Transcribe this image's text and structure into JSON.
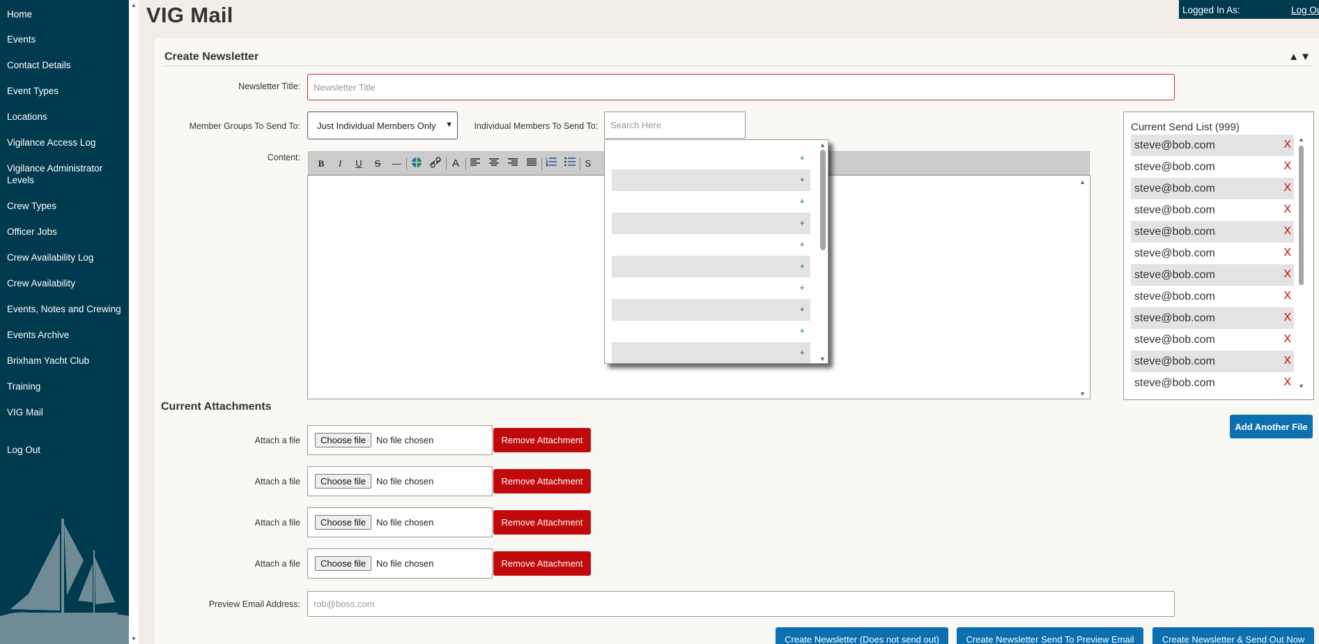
{
  "app": {
    "title": "VIG Mail",
    "logged_in_label": "Logged In As:",
    "logout_link": "Log Out"
  },
  "sidebar": {
    "items": [
      {
        "label": "Home"
      },
      {
        "label": "Events"
      },
      {
        "label": "Contact Details"
      },
      {
        "label": "Event Types"
      },
      {
        "label": "Locations"
      },
      {
        "label": "Vigilance Access Log"
      },
      {
        "label": "Vigilance Administrator Levels"
      },
      {
        "label": "Crew Types"
      },
      {
        "label": "Officer Jobs"
      },
      {
        "label": "Crew Availability Log"
      },
      {
        "label": "Crew Availability"
      },
      {
        "label": "Events, Notes and Crewing"
      },
      {
        "label": "Events Archive"
      },
      {
        "label": "Brixham Yacht Club"
      },
      {
        "label": "Training"
      },
      {
        "label": "VIG Mail"
      },
      {
        "label": "Log Out"
      }
    ]
  },
  "panel": {
    "title": "Create Newsletter",
    "toggle": "▲▼"
  },
  "form": {
    "title_label": "Newsletter Title:",
    "title_placeholder": "Newsletter Title",
    "groups_label": "Member Groups To Send To:",
    "groups_selected": "Just Individual Members Only",
    "individuals_label": "Individual Members To Send To:",
    "search_placeholder": "Search Here",
    "content_label": "Content:",
    "preview_label": "Preview Email Address:",
    "preview_placeholder": "rob@boss.com"
  },
  "toolbar": {
    "bold": "B",
    "italic": "I",
    "underline": "U",
    "strike": "S",
    "hr": "—",
    "font_size": "A",
    "source": "S"
  },
  "search_results": {
    "rows": [
      {
        "add": "+"
      },
      {
        "add": "+"
      },
      {
        "add": "+"
      },
      {
        "add": "+"
      },
      {
        "add": "+"
      },
      {
        "add": "+"
      },
      {
        "add": "+"
      },
      {
        "add": "+"
      },
      {
        "add": "+"
      },
      {
        "add": "+"
      }
    ]
  },
  "send_list": {
    "title": "Current Send List (999)",
    "remove_label": "X",
    "emails": [
      "steve@bob.com",
      "steve@bob.com",
      "steve@bob.com",
      "steve@bob.com",
      "steve@bob.com",
      "steve@bob.com",
      "steve@bob.com",
      "steve@bob.com",
      "steve@bob.com",
      "steve@bob.com",
      "steve@bob.com",
      "steve@bob.com"
    ]
  },
  "attachments": {
    "title": "Current Attachments",
    "attach_label": "Attach a file",
    "choose_label": "Choose file",
    "no_file": "No file chosen",
    "remove_label": "Remove Attachment",
    "add_label": "Add Another File"
  },
  "actions": {
    "create": "Create Newsletter (Does not send out)",
    "create_preview": "Create Newsletter Send To Preview Email",
    "create_send": "Create Newsletter & Send Out Now"
  },
  "colors": {
    "sidebar": "#003a4f",
    "accent_blue": "#0b6fb0",
    "remove_red": "#c1080a",
    "plus_green": "#1a8a1a"
  }
}
